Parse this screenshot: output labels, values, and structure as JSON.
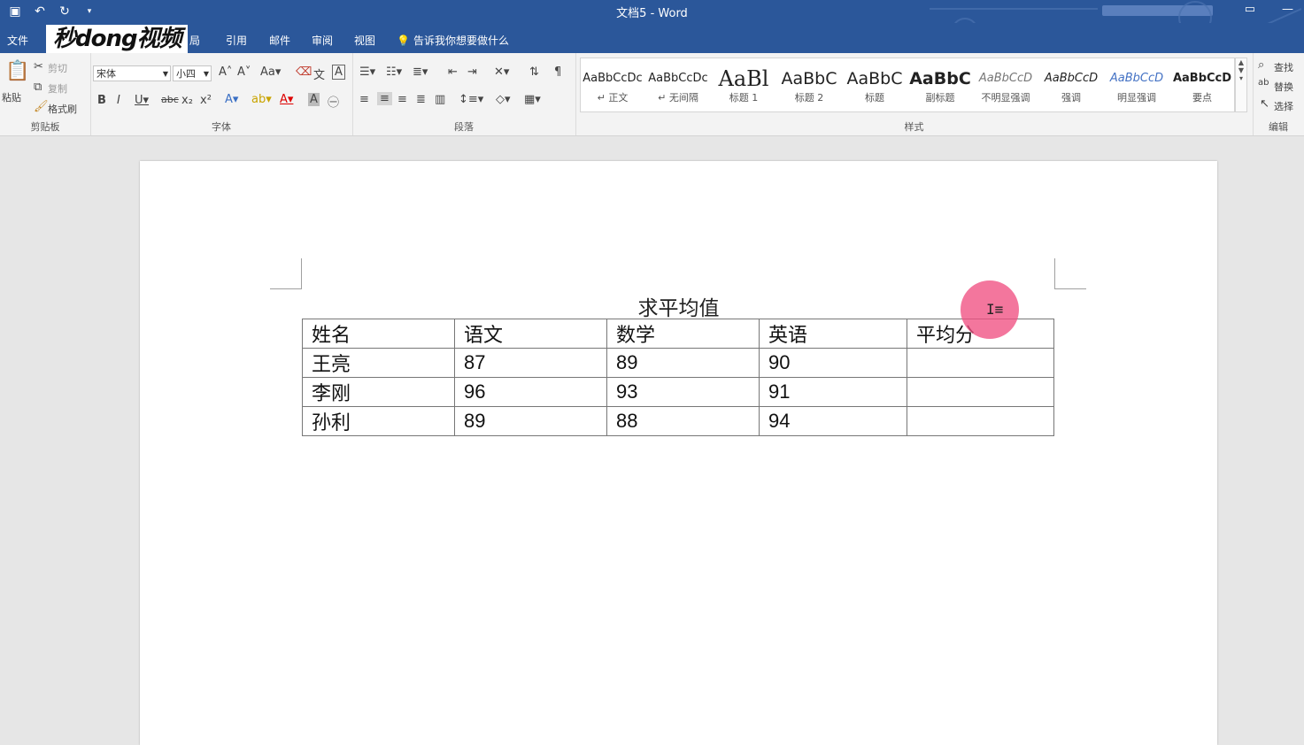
{
  "window": {
    "title": "文档5  -  Word"
  },
  "quick_access": {
    "save_icon": "save-icon",
    "undo_icon": "undo-icon",
    "redo_icon": "redo-icon",
    "customize_icon": "customize-icon"
  },
  "watermark": {
    "text": "秒dong视频"
  },
  "tabs": {
    "file": "文件",
    "layout_partial": "局",
    "references": "引用",
    "mailings": "邮件",
    "review": "审阅",
    "view": "视图",
    "tell_me": "告诉我你想要做什么"
  },
  "clipboard": {
    "paste": "粘贴",
    "cut": "剪切",
    "copy": "复制",
    "format_painter": "格式刷",
    "label": "剪贴板"
  },
  "font": {
    "name": "宋体",
    "size": "小四",
    "label": "字体"
  },
  "paragraph": {
    "label": "段落"
  },
  "styles": {
    "label": "样式",
    "items": [
      {
        "sample": "AaBbCcDc",
        "name": "↵ 正文"
      },
      {
        "sample": "AaBbCcDc",
        "name": "↵ 无间隔"
      },
      {
        "sample": "AaBl",
        "name": "标题 1"
      },
      {
        "sample": "AaBbC",
        "name": "标题 2"
      },
      {
        "sample": "AaBbC",
        "name": "标题"
      },
      {
        "sample": "AaBbC",
        "name": "副标题"
      },
      {
        "sample": "AaBbCcD",
        "name": "不明显强调"
      },
      {
        "sample": "AaBbCcD",
        "name": "强调"
      },
      {
        "sample": "AaBbCcD",
        "name": "明显强调"
      },
      {
        "sample": "AaBbCcD",
        "name": "要点"
      }
    ]
  },
  "editing": {
    "find": "查找",
    "replace": "替换",
    "select": "选择",
    "label": "编辑"
  },
  "document": {
    "heading": "求平均值",
    "table": {
      "headers": [
        "姓名",
        "语文",
        "数学",
        "英语",
        "平均分"
      ],
      "rows": [
        [
          "王亮",
          "87",
          "89",
          "90",
          ""
        ],
        [
          "李刚",
          "96",
          "93",
          "91",
          ""
        ],
        [
          "孙利",
          "89",
          "88",
          "94",
          ""
        ]
      ]
    }
  },
  "colors": {
    "accent": "#2b579a",
    "cursor_highlight": "#f05082"
  }
}
